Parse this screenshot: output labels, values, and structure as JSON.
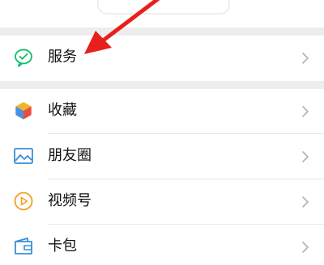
{
  "menu": {
    "service": {
      "label": "服务",
      "icon": "service-icon"
    },
    "items": [
      {
        "label": "收藏",
        "icon": "favorites-cube-icon"
      },
      {
        "label": "朋友圈",
        "icon": "moments-picture-icon"
      },
      {
        "label": "视频号",
        "icon": "channels-play-icon"
      },
      {
        "label": "卡包",
        "icon": "card-wallet-icon"
      }
    ]
  },
  "colors": {
    "gap_gray": "#ededed",
    "text": "#111111",
    "chevron": "#b2b2b2",
    "service_green": "#07c160",
    "annotation_arrow": "#e8201b"
  }
}
